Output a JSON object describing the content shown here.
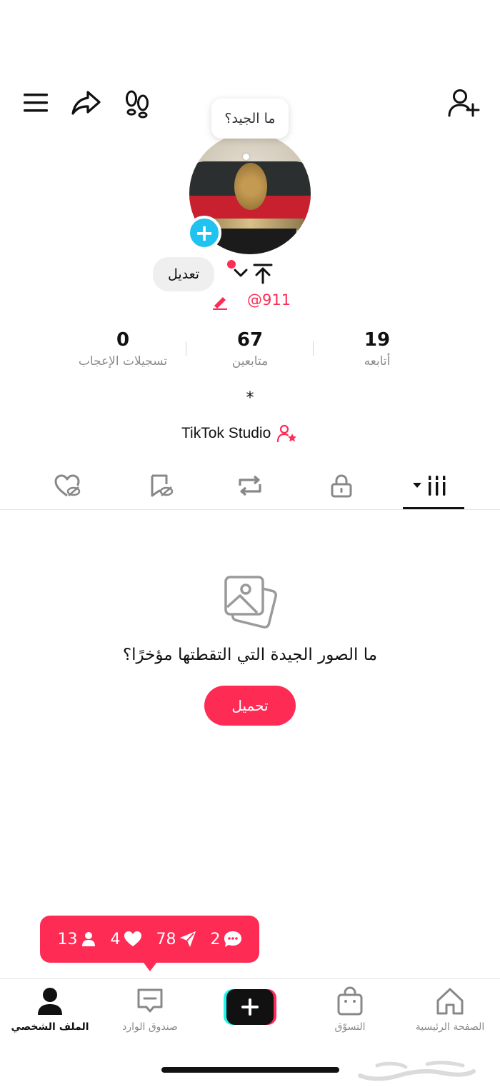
{
  "top_bar": {
    "icons": [
      "menu-icon",
      "share-icon",
      "footprint-icon",
      "add-friend-icon"
    ]
  },
  "profile": {
    "bubble_text": "ما الجيد؟",
    "edit_label": "تعديل",
    "username": "@911",
    "stats": {
      "likes_value": "0",
      "likes_label": "تسجيلات الإعجاب",
      "followers_value": "67",
      "followers_label": "متابعين",
      "following_value": "19",
      "following_label": "أتابعه"
    },
    "bio": "*",
    "studio_label": "TikTok Studio"
  },
  "tabs": {
    "items": [
      "liked-hidden-icon",
      "favorites-hidden-icon",
      "repost-icon",
      "lock-icon",
      "videos-grid-icon"
    ],
    "active": "videos"
  },
  "empty_state": {
    "message": "ما الصور الجيدة التي التقطتها مؤخرًا؟",
    "upload_label": "تحميل"
  },
  "notifications": {
    "comments": "2",
    "shares": "78",
    "likes": "4",
    "followers": "13"
  },
  "bottom_nav": {
    "profile": "الملف الشخصي",
    "inbox": "صندوق الوارد",
    "create": "+",
    "shop": "التسوّق",
    "home": "الصفحة الرئيسية"
  },
  "colors": {
    "accent": "#fe2c55",
    "avatar_add": "#20c2ef",
    "text": "#111111",
    "muted": "#8a8a8a"
  }
}
